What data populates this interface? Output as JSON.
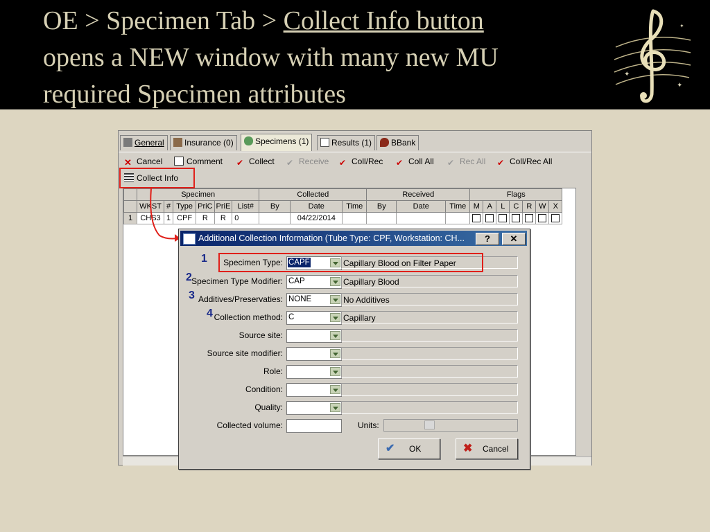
{
  "slide": {
    "title_line1_prefix": "OE > Specimen Tab > ",
    "title_line1_link": "Collect Info button",
    "title_line2": "opens a NEW window with many new MU",
    "title_line3": "required Specimen attributes"
  },
  "tabs": [
    {
      "label": "General",
      "icon": "general-icon"
    },
    {
      "label": "Insurance (0)",
      "icon": "insurance-icon"
    },
    {
      "label": "Specimens (1)",
      "icon": "specimen-icon"
    },
    {
      "label": "Results (1)",
      "icon": "results-icon"
    },
    {
      "label": "BBank",
      "icon": "bbank-icon"
    }
  ],
  "toolbar": {
    "cancel": "Cancel",
    "comment": "Comment",
    "collect": "Collect",
    "receive": "Receive",
    "coll_rec": "Coll/Rec",
    "coll_all": "Coll All",
    "rec_all": "Rec All",
    "coll_rec_all": "Coll/Rec All",
    "collect_info": "Collect Info"
  },
  "grid": {
    "groups": {
      "specimen": "Specimen",
      "collected": "Collected",
      "received": "Received",
      "flags": "Flags"
    },
    "columns": [
      "WKST",
      "#",
      "Type",
      "PriC",
      "PriE",
      "List#",
      "By",
      "Date",
      "Time",
      "By",
      "Date",
      "Time",
      "M",
      "A",
      "L",
      "C",
      "R",
      "W",
      "X"
    ],
    "row": {
      "num": "1",
      "wkst": "CHS3",
      "n": "1",
      "type": "CPF",
      "pric": "R",
      "prie": "R",
      "list": "0",
      "coll_by": "",
      "coll_date": "04/22/2014",
      "coll_time": "",
      "rec_by": "",
      "rec_date": "",
      "rec_time": ""
    }
  },
  "dialog": {
    "title": "Additional Collection Information (Tube Type: CPF, Workstation: CH...",
    "help": "?",
    "close": "✕",
    "fields": [
      {
        "num": "1",
        "label": "Specimen Type:",
        "code": "CAPF",
        "desc": "Capillary Blood on Filter Paper"
      },
      {
        "num": "2",
        "label": "Specimen Type Modifier:",
        "code": "CAP",
        "desc": "Capillary Blood"
      },
      {
        "num": "3",
        "label": "Additives/Preservaties:",
        "code": "NONE",
        "desc": "No Additives"
      },
      {
        "num": "4",
        "label": "Collection method:",
        "code": "C",
        "desc": "Capillary"
      },
      {
        "num": "",
        "label": "Source site:",
        "code": "",
        "desc": ""
      },
      {
        "num": "",
        "label": "Source site modifier:",
        "code": "",
        "desc": ""
      },
      {
        "num": "",
        "label": "Role:",
        "code": "",
        "desc": ""
      },
      {
        "num": "",
        "label": "Condition:",
        "code": "",
        "desc": ""
      },
      {
        "num": "",
        "label": "Quality:",
        "code": "",
        "desc": ""
      }
    ],
    "volume_label": "Collected volume:",
    "volume_value": "",
    "units_label": "Units:",
    "ok": "OK",
    "cancel": "Cancel"
  }
}
